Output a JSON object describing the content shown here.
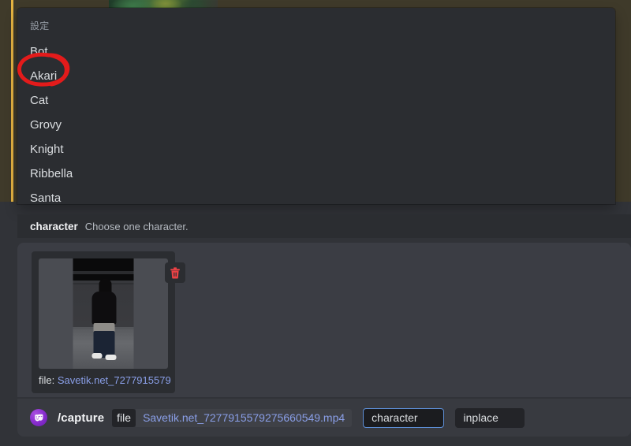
{
  "popup": {
    "header": "設定",
    "items": [
      {
        "label": "Bot"
      },
      {
        "label": "Akari"
      },
      {
        "label": "Cat"
      },
      {
        "label": "Grovy"
      },
      {
        "label": "Knight"
      },
      {
        "label": "Ribbella"
      },
      {
        "label": "Santa"
      }
    ],
    "annotated_item": "Akari",
    "annotation_color": "#e31b1b"
  },
  "option_hint": {
    "name": "character",
    "description": "Choose one character."
  },
  "attachment": {
    "filename_prefix": "file: ",
    "filename_truncated": "Savetik.net_7277915579…",
    "delete_icon": "trash-icon",
    "delete_icon_color": "#ed4245"
  },
  "command_bar": {
    "bot_icon": "theater-masks-icon",
    "command": "/capture",
    "arg_key": "file",
    "arg_value": "Savetik.net_7277915579275660549.mp4",
    "options": [
      {
        "label": "character",
        "active": true
      },
      {
        "label": "inplace",
        "active": false
      }
    ]
  },
  "colors": {
    "mention_accent": "#e5b341",
    "mention_bg": "#3f3a2a",
    "popup_bg": "#2b2d31",
    "panel_bg": "#3b3d44",
    "input_bg": "#383a40",
    "link": "#8a9fe8",
    "focus_border": "#5d8fd6"
  }
}
